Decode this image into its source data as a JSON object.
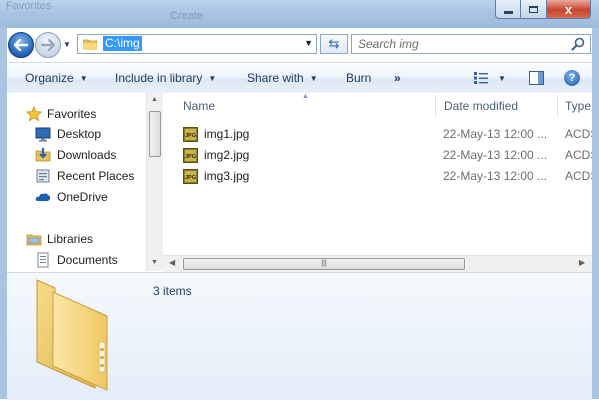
{
  "window": {
    "background_hint": "Favorites",
    "background_hint_2": "Create",
    "controls": {
      "minimize_label": "minimize",
      "maximize_label": "maximize",
      "close_label": "close",
      "close_glyph": "x"
    }
  },
  "navigation": {
    "back_glyph": "←",
    "forward_glyph": "→",
    "recent_glyph": "▼",
    "address": "C:\\img",
    "address_dropdown_glyph": "▼",
    "refresh_glyph": "⇆",
    "search_placeholder": "Search img"
  },
  "commandbar": {
    "organize": "Organize",
    "include_in_library": "Include in library",
    "share_with": "Share with",
    "burn": "Burn",
    "more": "»",
    "help_glyph": "?"
  },
  "navpane": {
    "items": [
      {
        "label": "Favorites",
        "icon": "star-icon",
        "level": "group"
      },
      {
        "label": "Desktop",
        "icon": "desktop-icon",
        "level": "child"
      },
      {
        "label": "Downloads",
        "icon": "downloads-icon",
        "level": "child"
      },
      {
        "label": "Recent Places",
        "icon": "recent-places-icon",
        "level": "child"
      },
      {
        "label": "OneDrive",
        "icon": "onedrive-icon",
        "level": "child"
      },
      {
        "label": "Libraries",
        "icon": "libraries-icon",
        "level": "group"
      },
      {
        "label": "Documents",
        "icon": "documents-icon",
        "level": "child"
      }
    ]
  },
  "filelist": {
    "columns": {
      "name": "Name",
      "date_modified": "Date modified",
      "type": "Type"
    },
    "rows": [
      {
        "name": "img1.jpg",
        "date_modified": "22-May-13 12:00 ...",
        "type": "ACDS"
      },
      {
        "name": "img2.jpg",
        "date_modified": "22-May-13 12:00 ...",
        "type": "ACDS"
      },
      {
        "name": "img3.jpg",
        "date_modified": "22-May-13 12:00 ...",
        "type": "ACDS"
      }
    ],
    "jpg_badge": "JPG"
  },
  "details": {
    "item_count": "3 items"
  },
  "colors": {
    "accent_selection": "#3399ff",
    "close_button": "#c8452d",
    "commandbar_text": "#1e395b"
  }
}
